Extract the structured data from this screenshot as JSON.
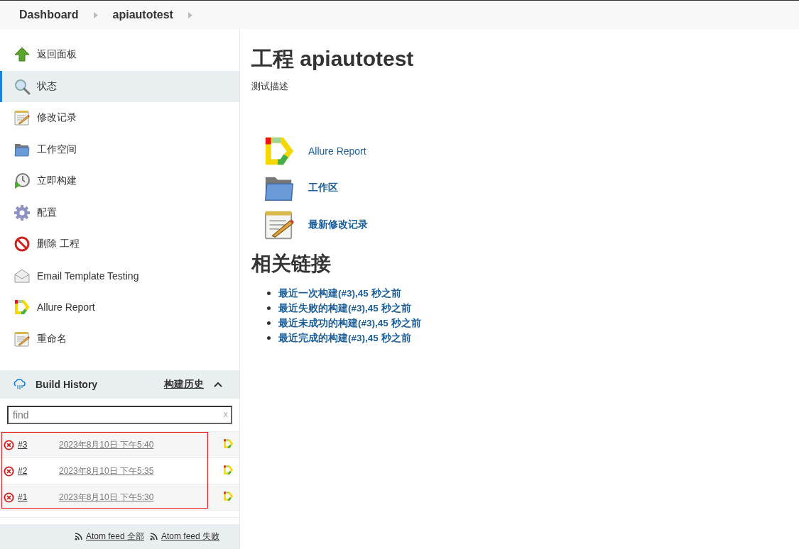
{
  "breadcrumb": [
    {
      "label": "Dashboard"
    },
    {
      "label": "apiautotest"
    }
  ],
  "sidebar": {
    "items": [
      {
        "label": "返回面板",
        "selected": false
      },
      {
        "label": "状态",
        "selected": true
      },
      {
        "label": "修改记录",
        "selected": false
      },
      {
        "label": "工作空间",
        "selected": false
      },
      {
        "label": "立即构建",
        "selected": false
      },
      {
        "label": "配置",
        "selected": false
      },
      {
        "label": "删除 工程",
        "selected": false
      },
      {
        "label": "Email Template Testing",
        "selected": false
      },
      {
        "label": "Allure Report",
        "selected": false
      },
      {
        "label": "重命名",
        "selected": false
      }
    ]
  },
  "build_history": {
    "title": "Build History",
    "trend_link": "构建历史",
    "expanded": true,
    "search": {
      "placeholder": "find",
      "clear": "x"
    },
    "builds": [
      {
        "number": "#3",
        "time": "2023年8月10日 下午5:40",
        "failed": true
      },
      {
        "number": "#2",
        "time": "2023年8月10日 下午5:35",
        "failed": true
      },
      {
        "number": "#1",
        "time": "2023年8月10日 下午5:30",
        "failed": true
      }
    ],
    "feeds": [
      "Atom feed 全部",
      "Atom feed 失败"
    ]
  },
  "main": {
    "title": "工程 apiautotest",
    "description": "测试描述",
    "links": [
      {
        "label": "Allure Report"
      },
      {
        "label": "工作区"
      },
      {
        "label": "最新修改记录"
      }
    ],
    "related_title": "相关链接",
    "related": [
      "最近一次构建(#3),45 秒之前",
      "最近失败的构建(#3),45 秒之前",
      "最近未成功的构建(#3),45 秒之前",
      "最近完成的构建(#3),45 秒之前"
    ]
  }
}
